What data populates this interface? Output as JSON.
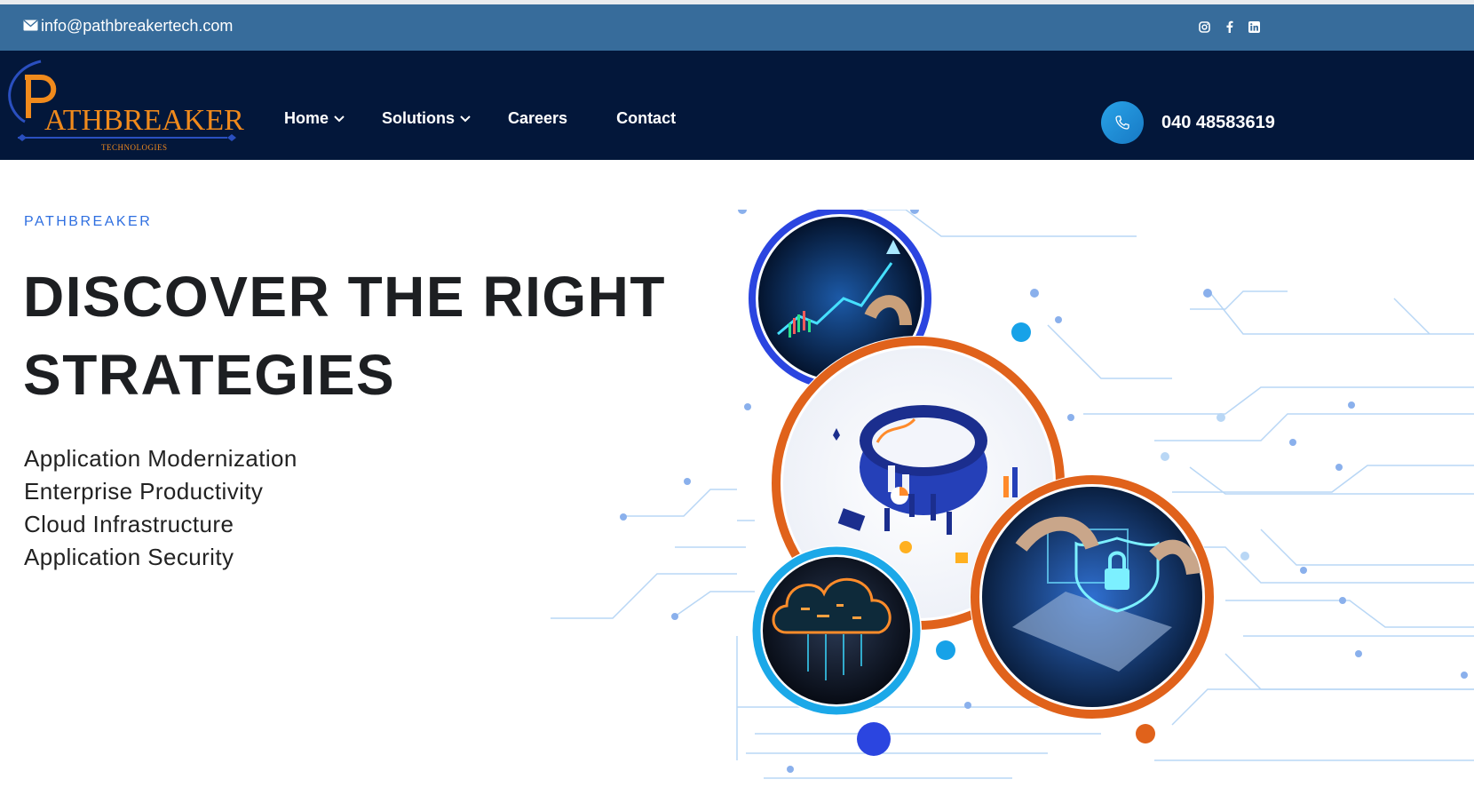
{
  "topbar": {
    "email": "info@pathbreakertech.com",
    "social": [
      "instagram-icon",
      "facebook-icon",
      "linkedin-icon"
    ]
  },
  "logo": {
    "wordmark": "ATHBREAKER",
    "tagline": "TECHNOLOGIES",
    "brand_initial": "P"
  },
  "nav": {
    "items": [
      {
        "label": "Home",
        "has_dropdown": true
      },
      {
        "label": "Solutions",
        "has_dropdown": true
      },
      {
        "label": "Careers",
        "has_dropdown": false
      },
      {
        "label": "Contact",
        "has_dropdown": false
      }
    ],
    "phone": "040 48583619"
  },
  "hero": {
    "eyebrow": "PATHBREAKER",
    "headline_line1": "DISCOVER THE RIGHT",
    "headline_line2": "STRATEGIES",
    "services": [
      "Application Modernization",
      "Enterprise Productivity",
      "Cloud Infrastructure",
      "Application Security"
    ]
  },
  "colors": {
    "topbar": "#376c9b",
    "navbar": "#03173a",
    "accent_orange": "#e0621b",
    "accent_blue": "#2f6fe0",
    "circuit": "#a9cdf0"
  }
}
